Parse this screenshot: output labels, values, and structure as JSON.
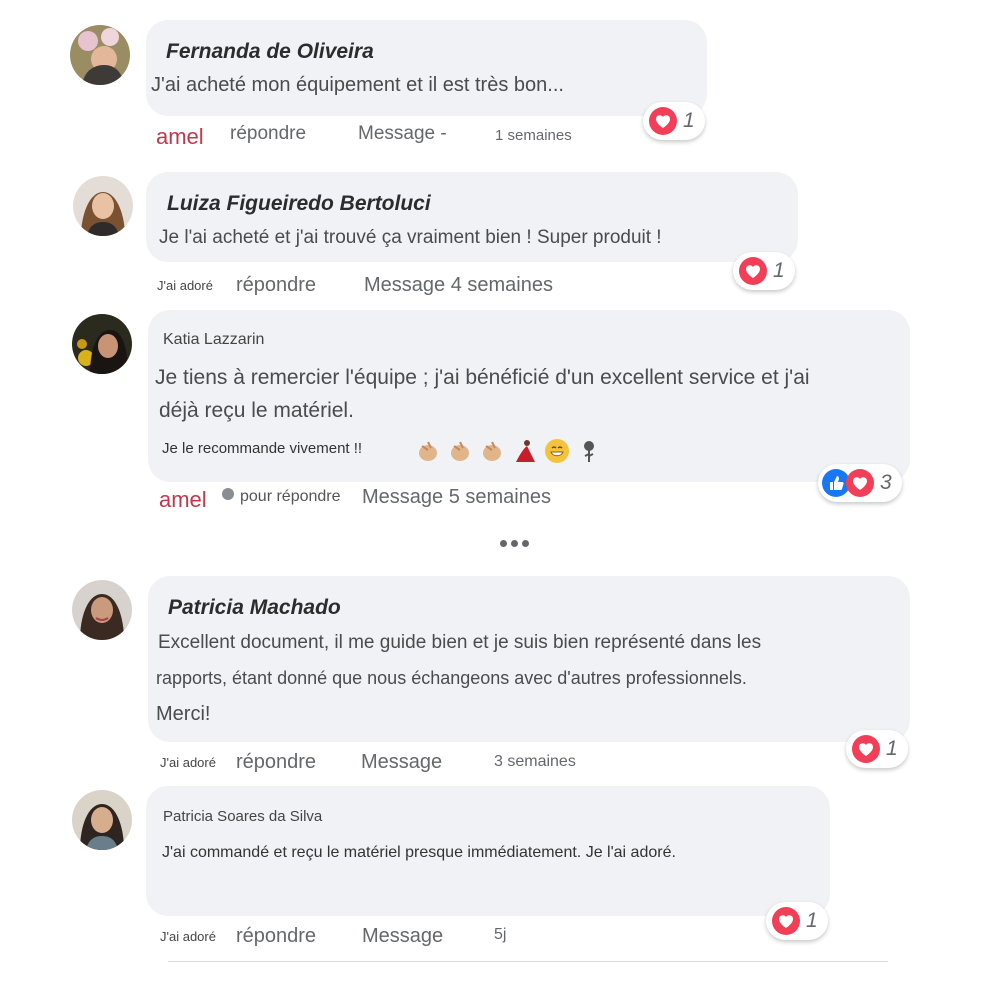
{
  "comments": [
    {
      "author": "Fernanda de Oliveira",
      "lines": [
        "J'ai acheté mon équipement et il est très bon..."
      ],
      "like_label": "amel",
      "reply_label": "répondre",
      "message_label": "Message -",
      "time": "1 semaines",
      "reaction_count": "1"
    },
    {
      "author": "Luiza Figueiredo Bertoluci",
      "lines": [
        "Je l'ai acheté et j'ai trouvé ça vraiment bien ! Super produit !"
      ],
      "like_label": "J'ai adoré",
      "reply_label": "répondre",
      "message_label": "Message 4 semaines",
      "reaction_count": "1"
    },
    {
      "author": "Katia Lazzarin",
      "lines": [
        "Je tiens à remercier l'équipe ; j'ai bénéficié d'un excellent service et j'ai",
        "déjà reçu le matériel.",
        "Je le recommande vivement !!"
      ],
      "like_label": "amel",
      "reply_label": "pour répondre",
      "message_label": "Message 5 semaines",
      "reaction_count": "3"
    },
    {
      "author": "Patricia Machado",
      "lines": [
        "Excellent document, il me guide bien et je suis bien représenté dans les",
        "rapports, étant donné que nous échangeons avec d'autres professionnels.",
        "Merci!"
      ],
      "like_label": "J'ai adoré",
      "reply_label": "répondre",
      "message_label": "Message",
      "time": "3 semaines",
      "reaction_count": "1"
    },
    {
      "author": "Patricia Soares da Silva",
      "lines": [
        "J'ai commandé et reçu le matériel presque immédiatement. Je l'ai adoré."
      ],
      "like_label": "J'ai adoré",
      "reply_label": "répondre",
      "message_label": "Message",
      "time": "5j",
      "reaction_count": "1"
    }
  ],
  "icons": {
    "love_reaction": "heart-icon",
    "like_reaction": "thumbs-up-icon",
    "more": "ellipsis-icon",
    "emojis": [
      "clapping-hands-icon",
      "clapping-hands-icon",
      "clapping-hands-icon",
      "dancer-icon",
      "grinning-face-icon",
      "rose-icon"
    ]
  },
  "colors": {
    "bubble": "#f0f2f5",
    "love": "#f33e58",
    "like": "#1877f2",
    "amel": "#c0394b"
  }
}
